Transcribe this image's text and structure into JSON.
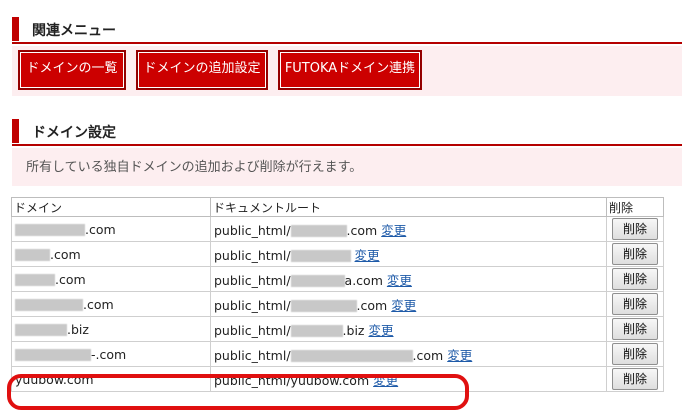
{
  "related_menu": {
    "title": "関連メニュー",
    "buttons": [
      "ドメインの一覧",
      "ドメインの追加設定",
      "FUTOKAドメイン連携"
    ]
  },
  "domain_settings": {
    "title": "ドメイン設定",
    "description": "所有している独自ドメインの追加および削除が行えます。"
  },
  "table": {
    "headers": [
      "ドメイン",
      "ドキュメントルート",
      "削除"
    ],
    "change_label": "変更",
    "delete_label": "削除",
    "rows": [
      {
        "domain_visible": ".com",
        "root_prefix": "public_html/",
        "root_suffix": ".com"
      },
      {
        "domain_visible": ".com",
        "root_prefix": "public_html/",
        "root_suffix": ""
      },
      {
        "domain_visible": ".com",
        "root_prefix": "public_html/",
        "root_suffix": "a.com"
      },
      {
        "domain_visible": ".com",
        "root_prefix": "public_html/",
        "root_suffix": ".com"
      },
      {
        "domain_visible": ".biz",
        "root_prefix": "public_html/",
        "root_suffix": ".biz"
      },
      {
        "domain_visible": "-.com",
        "root_prefix": "public_html/",
        "root_suffix": ".com"
      },
      {
        "domain_visible": "yuubow.com",
        "root_prefix": "public_html/yuubow.com",
        "root_suffix": ""
      }
    ]
  },
  "colors": {
    "accent": "#c00000",
    "panel": "#fdeef0",
    "link": "#1e5aa8",
    "highlight": "#e01010"
  }
}
